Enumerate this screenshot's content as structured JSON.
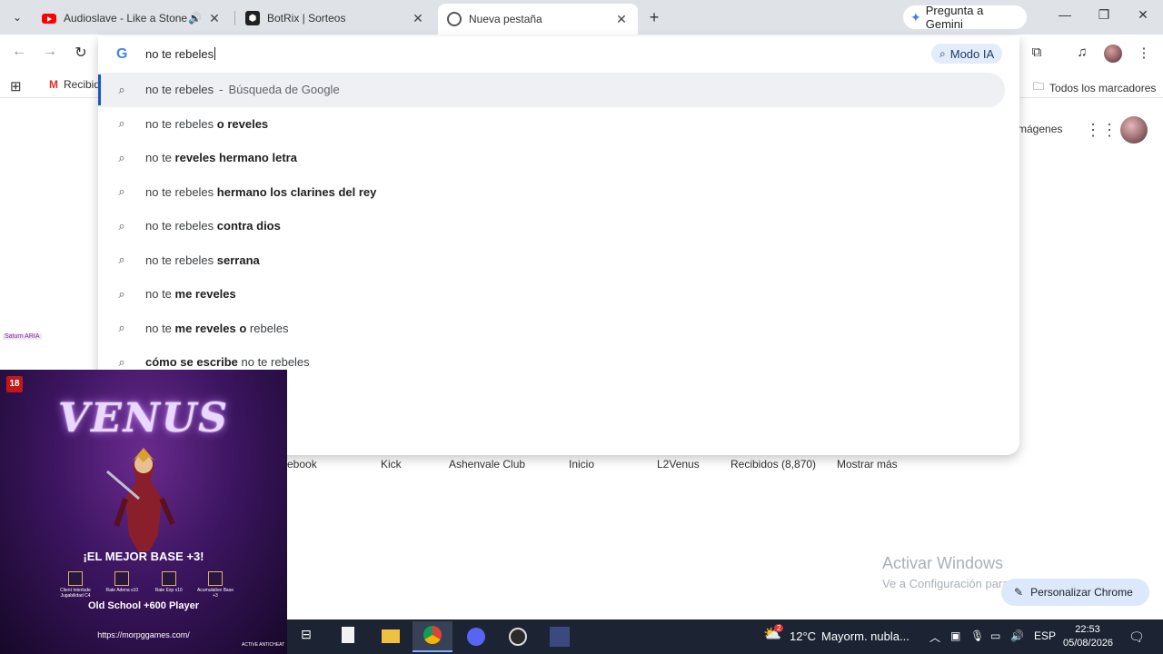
{
  "tabs": [
    {
      "title": "Audioslave - Like a Stone (C",
      "icon": "youtube-icon",
      "audio": true
    },
    {
      "title": "BotRix | Sorteos",
      "icon": "botrix-icon"
    },
    {
      "title": "Nueva pestaña",
      "icon": "chrome-icon",
      "active": true
    }
  ],
  "gemini_label": "Pregunta a Gemini",
  "omnibox": {
    "query": "no te rebeles",
    "ai_mode_label": "Modo IA"
  },
  "suggestions": [
    {
      "plain": "no te rebeles",
      "bold": "",
      "sep": "-",
      "suffix": "Búsqueda de Google"
    },
    {
      "plain": "no te rebeles ",
      "bold": "o reveles"
    },
    {
      "plain": "no te ",
      "bold": "reveles hermano letra"
    },
    {
      "plain": "no te rebeles ",
      "bold": "hermano los clarines del rey"
    },
    {
      "plain": "no te rebeles ",
      "bold": "contra dios"
    },
    {
      "plain": "no te rebeles ",
      "bold": "serrana"
    },
    {
      "plain": "no te ",
      "bold": "me reveles"
    },
    {
      "plain": "no te ",
      "bold": "me reveles o",
      "tail": " rebeles"
    },
    {
      "plain": "",
      "bold": "cómo se escribe",
      "tail": " no te rebeles"
    }
  ],
  "bookmarks": {
    "gmail": "Recibid",
    "all": "Todos los marcadores"
  },
  "page": {
    "images_link": "mágenes",
    "shortcuts": [
      "ebook",
      "Kick",
      "Ashenvale Club",
      "Inicio",
      "L2Venus",
      "Recibidos (8,870)",
      "Mostrar más"
    ],
    "customize": "Personalizar Chrome",
    "watermark_title": "Activar Windows",
    "watermark_sub": "Ve a Configuración para activar Windows.",
    "overlay_tag": "Saturn ARIA"
  },
  "ad": {
    "age": "18",
    "logo": "VENUS",
    "headline": "¡EL MEJOR BASE +3!",
    "features": [
      "Client Interlude Jugabilidad C4",
      "Rate Adena x10",
      "Rate Exp x10",
      "Acumulative Base +3"
    ],
    "sub": "Old School +600 Player",
    "url": "https://morpggames.com/",
    "badge": "ACTIVE ANTICHEAT"
  },
  "taskbar": {
    "temp": "12°C",
    "weather": "Mayorm. nubla...",
    "lang": "ESP",
    "time": "22:53",
    "date": "05/08/2026",
    "weather_badge": "2"
  }
}
